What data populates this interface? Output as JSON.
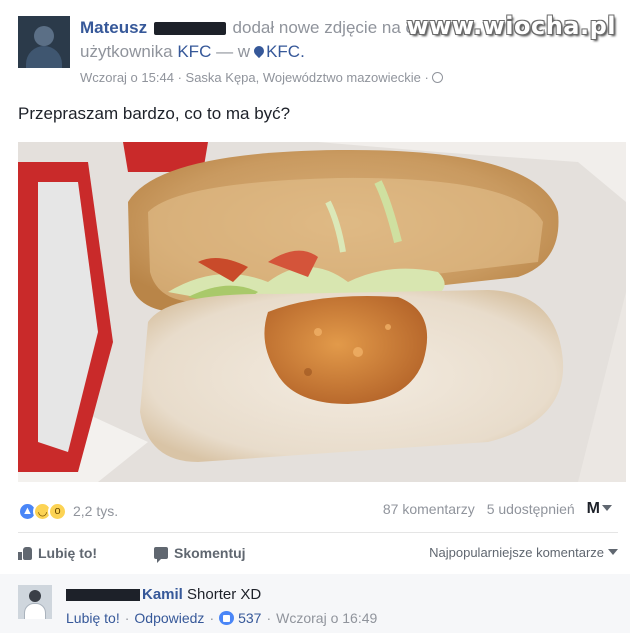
{
  "watermark": {
    "text": "www.wiocha.pl"
  },
  "post": {
    "author": "Mateusz",
    "action_text": "dodał nowe zdjęcie na osi cz",
    "line2_prefix": "użytkownika",
    "page_name": "KFC",
    "line2_sep": "— w",
    "place_name": "KFC.",
    "timestamp": "Wczoraj o 15:44",
    "location": "Saska Kępa, Województwo mazowieckie",
    "meta_dot": "·",
    "caption": "Przepraszam bardzo, co to ma być?"
  },
  "stats": {
    "reactions_count": "2,2 tys.",
    "comments": "87 komentarzy",
    "shares": "5 udostępnień",
    "reaction_icons": [
      "like-icon",
      "haha-icon",
      "wow-icon"
    ]
  },
  "actions": {
    "like": "Lubię to!",
    "comment": "Skomentuj",
    "sort": "Najpopularniejsze komentarze"
  },
  "comment": {
    "author": "Kamil",
    "text": "Shorter XD",
    "like_label": "Lubię to!",
    "reply_label": "Odpowiedz",
    "likes": "537",
    "time": "Wczoraj o 16:49",
    "sep": "·"
  },
  "colors": {
    "link": "#365899",
    "muted": "#90949c",
    "like_blue": "#4a86f7"
  }
}
